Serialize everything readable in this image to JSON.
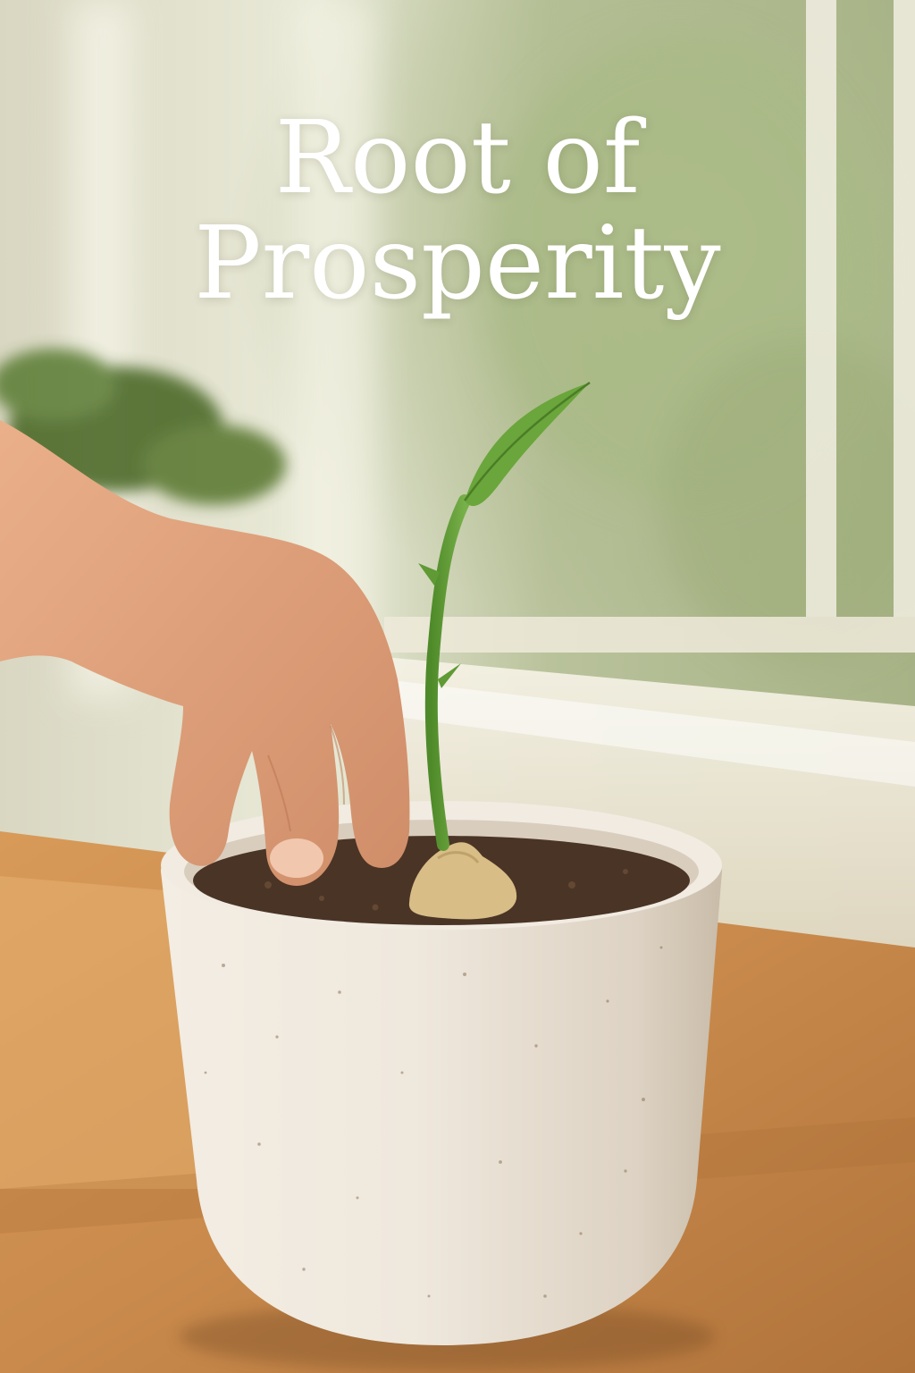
{
  "poster": {
    "title_line1": "Root of",
    "title_line2": "Prosperity"
  },
  "palette": {
    "window_light": "#eef0e0",
    "foliage": "#a9b98a",
    "wood_table": "#c98a4c",
    "pot": "#eee8de",
    "soil": "#4a3426",
    "sprout": "#5f9a35",
    "ginger": "#d8bd86",
    "skin": "#e3a57f"
  },
  "scene_elements": [
    "window",
    "blurred-plant",
    "hand",
    "ceramic-pot",
    "soil",
    "ginger-root",
    "sprout",
    "wooden-table"
  ]
}
